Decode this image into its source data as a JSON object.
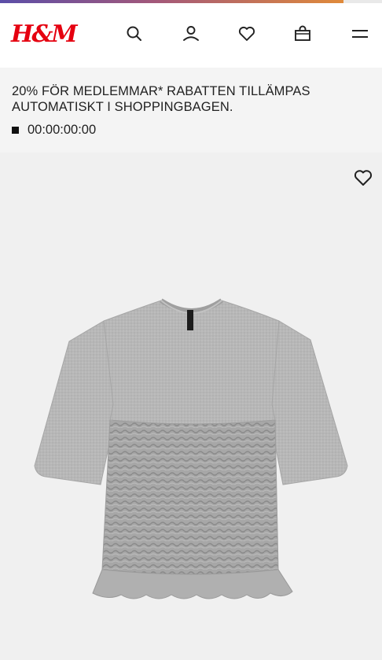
{
  "progress": {
    "fraction": 0.9
  },
  "header": {
    "logo_text": "H&M",
    "brand_color": "#e50010",
    "icons": [
      "search-icon",
      "account-icon",
      "favorites-icon",
      "shopping-bag-icon",
      "menu-icon"
    ]
  },
  "promo": {
    "text": "20% FÖR MEDLEMMAR* RABATTEN TILLÄMPAS AUTOMATISKT I SHOPPINGBAGEN.",
    "countdown": "00:00:00:00"
  },
  "product": {
    "favorite_icon": "heart-icon",
    "image": "grey-smocked-t-shirt",
    "background": "#f0f0f0"
  }
}
